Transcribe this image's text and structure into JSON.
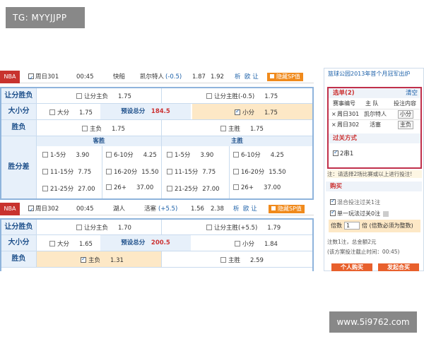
{
  "watermark_top": "TG: MYYJJPP",
  "watermark_bottom": "www.5i9762.com",
  "games": [
    {
      "league": "NBA",
      "code": "周日301",
      "time": "00:45",
      "away": "快船",
      "home": "凯尔特人",
      "home_handicap": "(-0.5)",
      "odds1": "1.87",
      "odds2": "1.92",
      "analysis": "析",
      "data_link": "欧 让",
      "sp_label": "隐藏SP值",
      "handicap": {
        "label": "让分胜负",
        "away": {
          "name": "让分主负",
          "odd": "1.75"
        },
        "home": {
          "name": "让分主胜(-0.5)",
          "odd": "1.75"
        }
      },
      "total": {
        "label": "大小分",
        "big": {
          "name": "大分",
          "odd": "1.75"
        },
        "preset_label": "预设总分",
        "preset_value": "184.5",
        "small": {
          "name": "小分",
          "odd": "1.75"
        }
      },
      "win_lose": {
        "label": "胜负",
        "away": {
          "name": "主负",
          "odd": "1.75"
        },
        "home": {
          "name": "主胜",
          "odd": "1.75"
        }
      },
      "margin": {
        "label": "胜分差",
        "away_head": "客胜",
        "home_head": "主胜",
        "away": [
          {
            "name": "1-5分",
            "odd": "3.90"
          },
          {
            "name": "6-10分",
            "odd": "4.25"
          },
          {
            "name": "11-15分",
            "odd": "7.75"
          },
          {
            "name": "16-20分",
            "odd": "15.50"
          },
          {
            "name": "21-25分",
            "odd": "27.00"
          },
          {
            "name": "26+",
            "odd": "37.00"
          }
        ],
        "home": [
          {
            "name": "1-5分",
            "odd": "3.90"
          },
          {
            "name": "6-10分",
            "odd": "4.25"
          },
          {
            "name": "11-15分",
            "odd": "7.75"
          },
          {
            "name": "16-20分",
            "odd": "15.50"
          },
          {
            "name": "21-25分",
            "odd": "27.00"
          },
          {
            "name": "26+",
            "odd": "37.00"
          }
        ]
      }
    },
    {
      "league": "NBA",
      "code": "周日302",
      "time": "00:45",
      "away": "湖人",
      "home": "活塞",
      "home_handicap": "(+5.5)",
      "odds1": "1.56",
      "odds2": "2.38",
      "analysis": "析",
      "data_link": "欧 让",
      "sp_label": "隐藏SP值",
      "handicap": {
        "label": "让分胜负",
        "away": {
          "name": "让分主负",
          "odd": "1.70"
        },
        "home": {
          "name": "让分主胜(+5.5)",
          "odd": "1.79"
        }
      },
      "total": {
        "label": "大小分",
        "big": {
          "name": "大分",
          "odd": "1.65"
        },
        "preset_label": "预设总分",
        "preset_value": "200.5",
        "small": {
          "name": "小分",
          "odd": "1.84"
        }
      },
      "win_lose": {
        "label": "胜负",
        "away": {
          "name": "主负",
          "odd": "1.31"
        },
        "home": {
          "name": "主胜",
          "odd": "2.59"
        }
      }
    }
  ],
  "sidebar": {
    "title": "篮球公园2013年首个月冠军出炉",
    "selection": {
      "header": "选单(2)",
      "clear": "清空",
      "cols": [
        "赛事编号",
        "主 队",
        "投注内容"
      ],
      "rows": [
        {
          "x": "×",
          "code": "周日301",
          "team": "凯尔特人",
          "bet": "小分"
        },
        {
          "x": "×",
          "code": "周日302",
          "team": "活塞",
          "bet": "主负"
        }
      ]
    },
    "pass": {
      "header": "过关方式",
      "option": "2串1"
    },
    "note": "注：请选择2场比赛或以上进行投注!",
    "buy": {
      "header": "购买",
      "opt1": "混合投注过关1注",
      "opt2": "单一玩法过关0注",
      "multiple_label": "倍数",
      "multiple_value": "1",
      "multiple_unit": "倍",
      "multiple_note": "(倍数必须为整数)",
      "summary": "注数1注，总金额2元",
      "deadline": "(该方案投注截止时间：00:45)",
      "btn_buy": "个人购买",
      "btn_group": "发起合买"
    }
  }
}
